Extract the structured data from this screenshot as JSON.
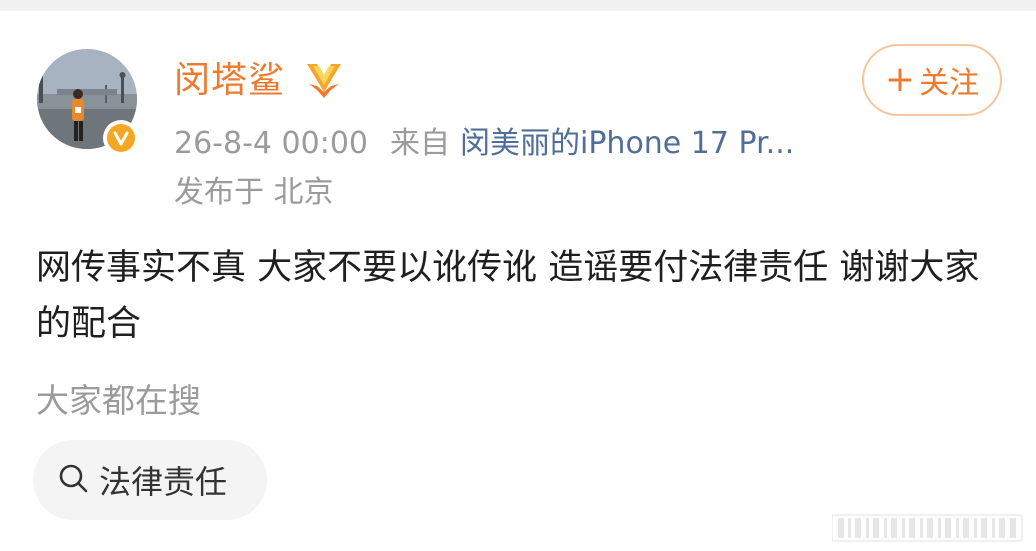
{
  "user": {
    "name": "闵塔鲨",
    "avatar_icon": "avatar-photo",
    "verified_icon": "verified-v-badge",
    "rank_icon": "fan-rank-badge"
  },
  "follow_button": {
    "plus": "+",
    "label": "关注"
  },
  "meta": {
    "timestamp": "26-8-4 00:00",
    "from_label": "来自",
    "source": "闵美丽的iPhone 17 Pr...",
    "location": "发布于 北京"
  },
  "post": {
    "text": "网传事实不真 大家不要以讹传讹 造谣要付法律责任 谢谢大家的配合"
  },
  "search": {
    "title": "大家都在搜",
    "chips": [
      {
        "label": "法律责任",
        "icon": "search-icon"
      }
    ]
  },
  "colors": {
    "accent": "#ee7a2d",
    "link": "#4f6e9a",
    "muted": "#9b9b9b",
    "badge": "#f5a623"
  }
}
